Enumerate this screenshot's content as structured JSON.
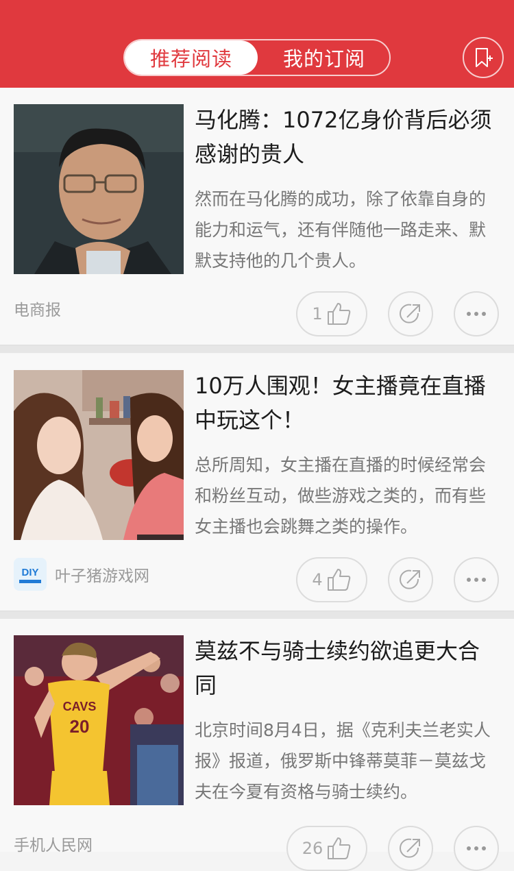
{
  "header": {
    "tabs": [
      {
        "label": "推荐阅读",
        "active": true
      },
      {
        "label": "我的订阅",
        "active": false
      }
    ],
    "bookmark_icon": "bookmark-add-icon",
    "accent_color": "#e0393e"
  },
  "articles": [
    {
      "title": "马化腾：1072亿身价背后必须感谢的贵人",
      "summary": "然而在马化腾的成功，除了依靠自身的能力和运气，还有伴随他一路走来、默默支持他的几个贵人。",
      "source": "电商报",
      "likes": "1"
    },
    {
      "title": "10万人围观！女主播竟在直播中玩这个！",
      "summary": "总所周知，女主播在直播的时候经常会和粉丝互动，做些游戏之类的，而有些女主播也会跳舞之类的操作。",
      "source": "叶子猪游戏网",
      "source_logo_text": "DIY",
      "likes": "4"
    },
    {
      "title": "莫兹不与骑士续约欲追更大合同",
      "summary": "北京时间8月4日，据《克利夫兰老实人报》报道，俄罗斯中锋蒂莫菲－莫兹戈夫在今夏有资格与骑士续约。",
      "source": "手机人民网",
      "likes": "26",
      "jersey_text": "CAVS",
      "jersey_number": "20"
    }
  ]
}
